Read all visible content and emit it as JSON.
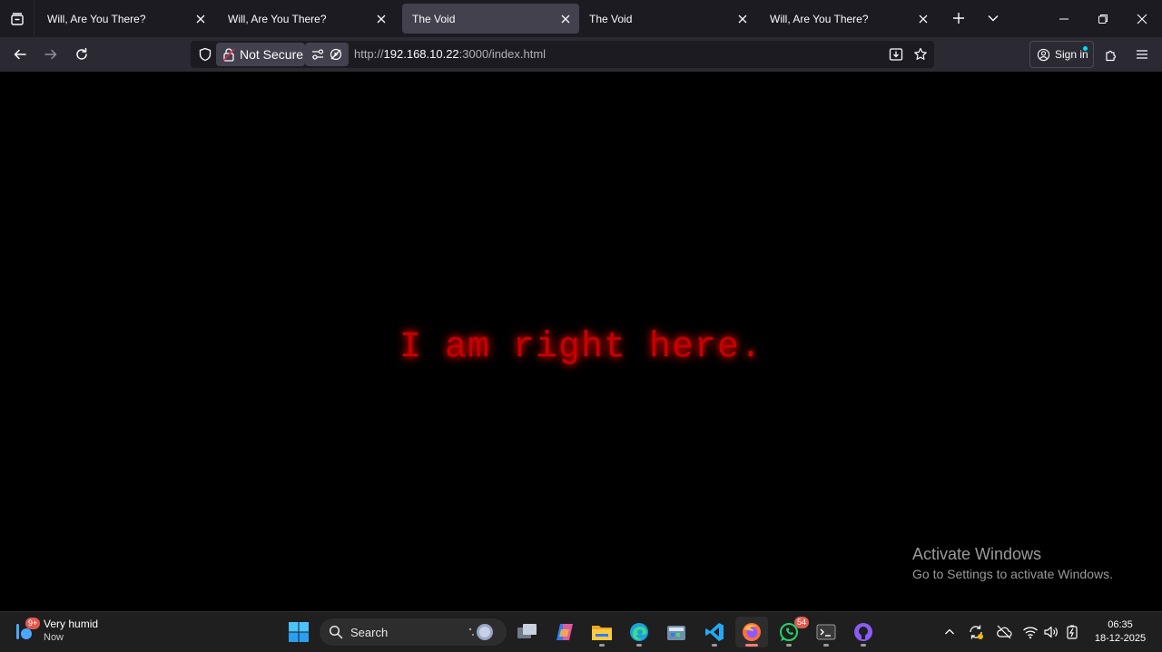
{
  "browser": {
    "tabs": [
      {
        "title": "Will, Are You There?",
        "selected": false
      },
      {
        "title": "Will, Are You There?",
        "selected": false
      },
      {
        "title": "The Void",
        "selected": true
      },
      {
        "title": "The Void",
        "selected": false
      },
      {
        "title": "Will, Are You There?",
        "selected": false
      }
    ],
    "url": {
      "scheme": "http://",
      "host": "192.168.10.22",
      "rest": ":3000/index.html"
    },
    "security_label": "Not Secure",
    "signin_label": "Sign in"
  },
  "page": {
    "message": "I am right here."
  },
  "watermark": {
    "title": "Activate Windows",
    "subtitle": "Go to Settings to activate Windows."
  },
  "taskbar": {
    "weather": {
      "badge": "9+",
      "condition": "Very humid",
      "time": "Now"
    },
    "search_label": "Search",
    "whatsapp_badge": "54",
    "apps": [
      "start-icon",
      "search",
      "task-view-icon",
      "copilot-icon",
      "file-explorer-icon",
      "edge-icon",
      "store-icon",
      "vscode-icon",
      "firefox-icon",
      "whatsapp-icon",
      "terminal-icon",
      "github-icon"
    ],
    "clock": {
      "time": "06:35",
      "date": "18-12-2025"
    }
  },
  "colors": {
    "message": "#c80000",
    "tabstrip": "#1c1b22",
    "toolbar": "#2b2a33",
    "taskbar": "#1f1f1f"
  }
}
